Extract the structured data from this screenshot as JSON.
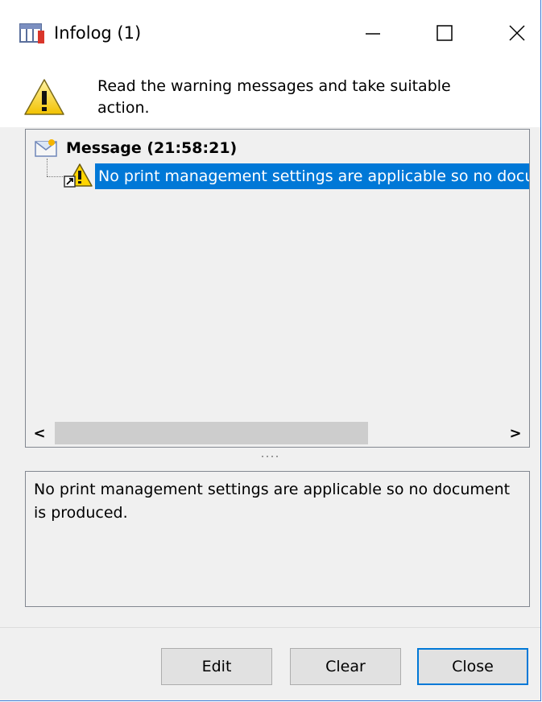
{
  "window": {
    "title": "Infolog (1)",
    "icons": {
      "app": "infolog-app-icon",
      "minimize": "minimize-icon",
      "maximize": "maximize-icon",
      "close": "close-icon"
    }
  },
  "header": {
    "icon": "warning-icon",
    "text": "Read the warning messages and take suitable action."
  },
  "tree": {
    "root": {
      "icon": "message-envelope-icon",
      "label": "Message (21:58:21)"
    },
    "items": [
      {
        "icon": "warning-icon",
        "label": "No print management settings are applicable so no document is produced.",
        "selected": true
      }
    ]
  },
  "scrollbar": {
    "left_arrow": "<",
    "right_arrow": ">"
  },
  "detail": {
    "text": "No print management settings are applicable so no document is produced."
  },
  "buttons": {
    "edit": "Edit",
    "clear": "Clear",
    "close": "Close"
  },
  "colors": {
    "selection": "#0078d7",
    "window_border": "#3a7bd5",
    "dialog_bg": "#f0f0f0"
  }
}
